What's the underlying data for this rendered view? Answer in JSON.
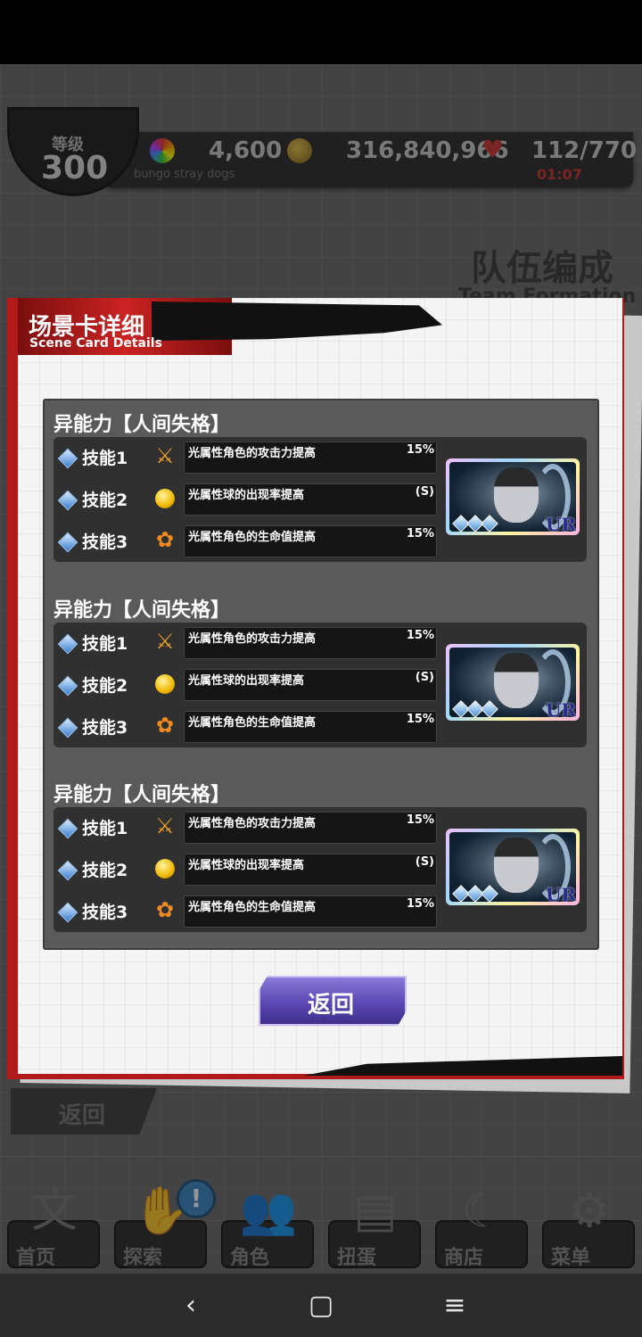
{
  "hud": {
    "level_label": "等级",
    "level_value": "300",
    "gems": "4,600",
    "coins": "316,840,966",
    "stamina": "112/770",
    "stamina_timer": "01:07",
    "subtitle": "bungo stray dogs",
    "colors": {
      "timer": "#cc3333"
    }
  },
  "background": {
    "page_title_cn": "队伍编成",
    "page_title_en": "Team Formation",
    "back_label": "返回"
  },
  "modal": {
    "title_cn": "场景卡详细",
    "title_en": "Scene Card Details",
    "abilities": [
      {
        "title": "异能力【人间失格】",
        "skills": [
          {
            "name": "技能1",
            "icon": "sword-icon",
            "desc": "光属性角色的攻击力提高",
            "value": "15%"
          },
          {
            "name": "技能2",
            "icon": "orb-icon",
            "desc": "光属性球的出现率提高",
            "value": "(S)"
          },
          {
            "name": "技能3",
            "icon": "heart-icon",
            "desc": "光属性角色的生命值提高",
            "value": "15%"
          }
        ],
        "card": {
          "rarity": "UR",
          "stars": 3
        }
      },
      {
        "title": "异能力【人间失格】",
        "skills": [
          {
            "name": "技能1",
            "icon": "sword-icon",
            "desc": "光属性角色的攻击力提高",
            "value": "15%"
          },
          {
            "name": "技能2",
            "icon": "orb-icon",
            "desc": "光属性球的出现率提高",
            "value": "(S)"
          },
          {
            "name": "技能3",
            "icon": "heart-icon",
            "desc": "光属性角色的生命值提高",
            "value": "15%"
          }
        ],
        "card": {
          "rarity": "UR",
          "stars": 3
        }
      },
      {
        "title": "异能力【人间失格】",
        "skills": [
          {
            "name": "技能1",
            "icon": "sword-icon",
            "desc": "光属性角色的攻击力提高",
            "value": "15%"
          },
          {
            "name": "技能2",
            "icon": "orb-icon",
            "desc": "光属性球的出现率提高",
            "value": "(S)"
          },
          {
            "name": "技能3",
            "icon": "heart-icon",
            "desc": "光属性角色的生命值提高",
            "value": "15%"
          }
        ],
        "card": {
          "rarity": "UR",
          "stars": 3
        }
      }
    ],
    "return_label": "返回",
    "colors": {
      "header_red": "#b01a1a",
      "return_button": "#5b48b5"
    }
  },
  "bottom_nav": [
    {
      "label": "首页",
      "icon": "home-icon"
    },
    {
      "label": "探索",
      "icon": "explore-icon"
    },
    {
      "label": "角色",
      "icon": "characters-icon"
    },
    {
      "label": "扭蛋",
      "icon": "gacha-icon"
    },
    {
      "label": "商店",
      "icon": "shop-icon"
    },
    {
      "label": "菜单",
      "icon": "gear-icon"
    }
  ],
  "alert_badge": "!"
}
